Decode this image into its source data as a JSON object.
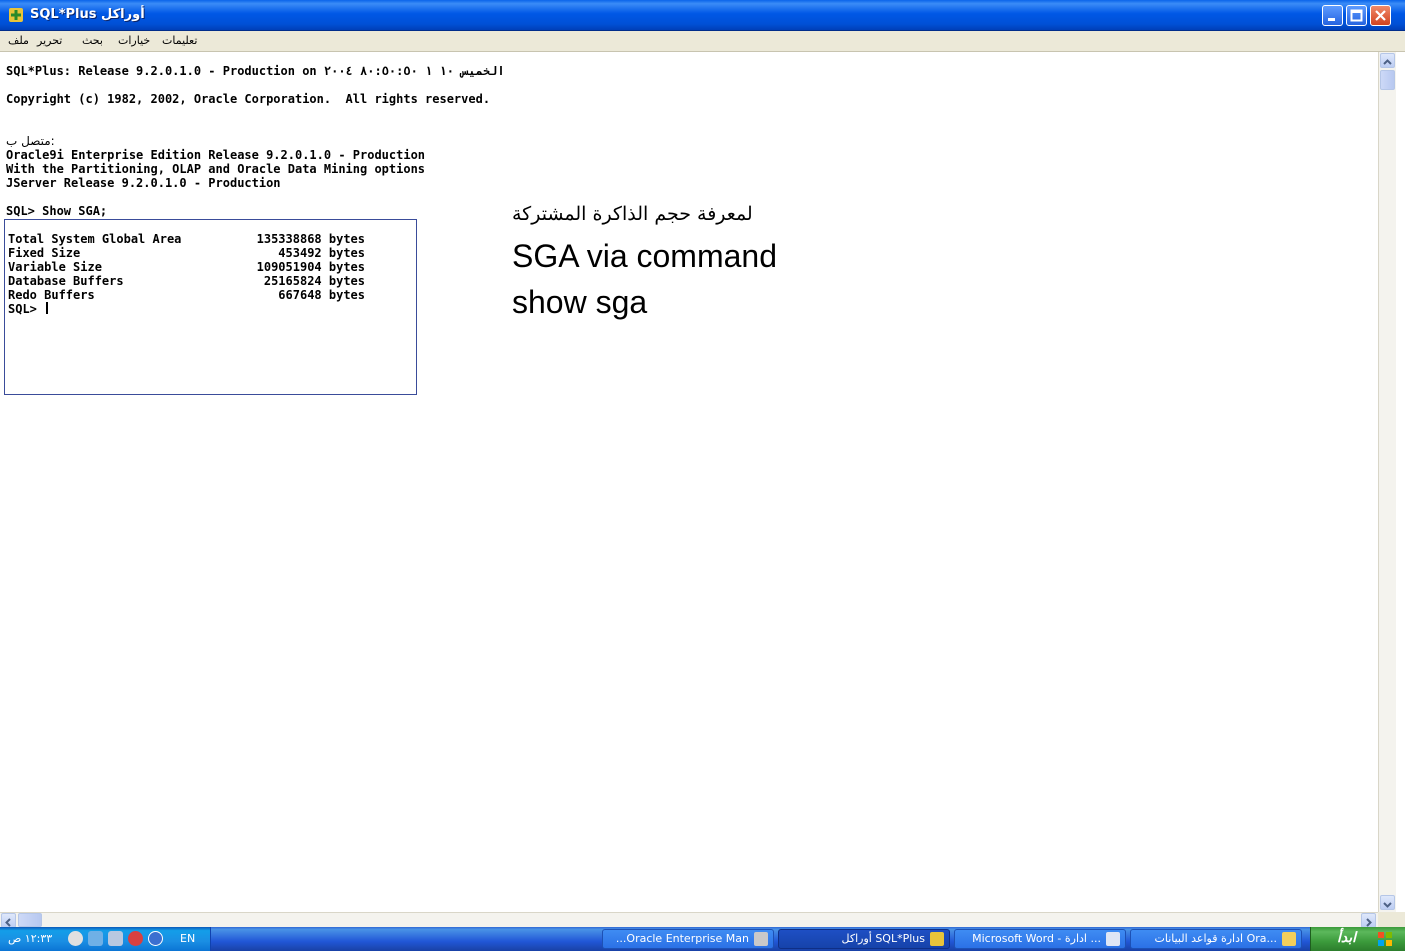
{
  "window": {
    "title": "أوراكل SQL*Plus"
  },
  "menu": {
    "items": [
      "ملف",
      "تحرير",
      "بحث",
      "خيارات",
      "تعليمات"
    ]
  },
  "console": {
    "release_line": "SQL*Plus: Release 9.2.0.1.0 - Production on الخميس ١٠ ١ ٨٠:٥٠:٥٠ ٢٠٠٤",
    "copyright_line": "Copyright (c) 1982, 2002, Oracle Corporation.  All rights reserved.",
    "connected_label": ":متصل ب",
    "banner": [
      "Oracle9i Enterprise Edition Release 9.2.0.1.0 - Production",
      "With the Partitioning, OLAP and Oracle Data Mining options",
      "JServer Release 9.2.0.1.0 - Production"
    ],
    "command": "SQL> Show SGA;",
    "sga_rows": [
      {
        "label": "Total System Global Area",
        "value": "135338868 bytes"
      },
      {
        "label": "Fixed Size",
        "value": "453492 bytes"
      },
      {
        "label": "Variable Size",
        "value": "109051904 bytes"
      },
      {
        "label": "Database Buffers",
        "value": "25165824 bytes"
      },
      {
        "label": "Redo Buffers",
        "value": "667648 bytes"
      }
    ],
    "prompt": "SQL>"
  },
  "annotation": {
    "arabic": "لمعرفة حجم الذاكرة المشتركة",
    "line1": "SGA via command",
    "line2": "show sga"
  },
  "taskbar": {
    "clock": "١٢:٣٣ ص",
    "language": "EN",
    "tasks": [
      {
        "label": "...Oracle Enterprise Man",
        "active": false
      },
      {
        "label": "أوراكل SQL*Plus",
        "active": true
      },
      {
        "label": "Microsoft Word - ادارة ...",
        "active": false
      },
      {
        "label": "ادارة قواعد البيانات Ora...",
        "active": false
      }
    ],
    "start_label": "ابدأ"
  },
  "colors": {
    "titlebar": "#0058e6",
    "taskbar": "#2157d7",
    "start": "#3c9b3c",
    "menubar": "#ece9d8",
    "box_border": "#3a4c9a"
  }
}
